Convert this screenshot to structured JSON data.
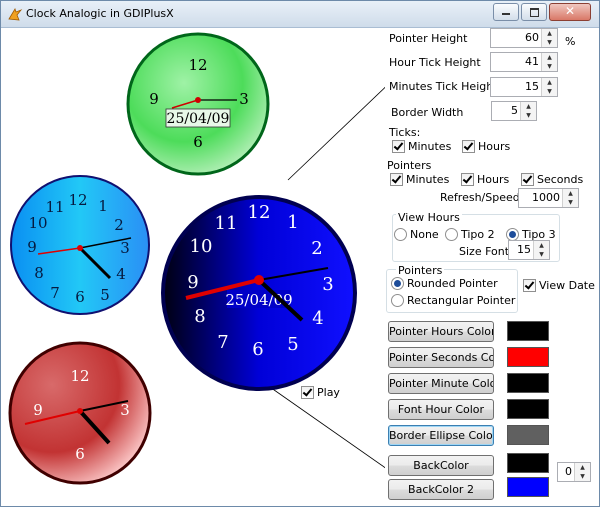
{
  "window": {
    "title": "Clock Analogic in GDIPlusX"
  },
  "clocks": {
    "green": {
      "n12": "12",
      "n3": "3",
      "n6": "6",
      "n9": "9",
      "date": "25/04/09"
    },
    "blue_small": {
      "numbers": [
        "12",
        "1",
        "2",
        "3",
        "4",
        "5",
        "6",
        "7",
        "8",
        "9",
        "10",
        "11"
      ]
    },
    "blue_big": {
      "numbers": [
        "12",
        "1",
        "2",
        "3",
        "4",
        "5",
        "6",
        "7",
        "8",
        "9",
        "10",
        "11"
      ],
      "date": "25/04/09"
    },
    "red": {
      "n12": "12",
      "n3": "3",
      "n6": "6",
      "n9": "9"
    }
  },
  "play": {
    "label": "Play",
    "checked": true
  },
  "settings": {
    "pointer_height": {
      "label": "Pointer Height",
      "value": "60",
      "unit": "%"
    },
    "hour_tick_height": {
      "label": "Hour Tick Height",
      "value": "41"
    },
    "minutes_tick_height": {
      "label": "Minutes Tick Height",
      "value": "15"
    },
    "border_width": {
      "label": "Border Width",
      "value": "5"
    },
    "ticks_label": "Ticks:",
    "ticks_minutes": "Minutes",
    "ticks_hours": "Hours",
    "pointers_label": "Pointers",
    "pointers_minutes": "Minutes",
    "pointers_hours": "Hours",
    "pointers_seconds": "Seconds",
    "refresh": {
      "label": "Refresh/Speed:",
      "value": "1000"
    },
    "view_hours": {
      "title": "View Hours",
      "none": "None",
      "tipo2": "Tipo 2",
      "tipo3": "Tipo 3",
      "selected": "Tipo 3"
    },
    "size_font": {
      "label": "Size Font",
      "value": "15"
    },
    "pointer_style": {
      "title": "Pointers",
      "rounded": "Rounded Pointer",
      "rectangular": "Rectangular Pointer",
      "selected": "Rounded Pointer"
    },
    "view_date": {
      "label": "View Date",
      "checked": true
    },
    "backcolor_index": "0"
  },
  "color_buttons": [
    {
      "label": "Pointer Hours Color",
      "color": "#000000"
    },
    {
      "label": "Pointer Seconds Col",
      "color": "#ff0000"
    },
    {
      "label": "Pointer Minute Color",
      "color": "#000000"
    },
    {
      "label": "Font Hour Color",
      "color": "#000000"
    },
    {
      "label": "Border Ellipse Color",
      "color": "#606060"
    },
    {
      "label": "BackColor",
      "color": "#000000"
    },
    {
      "label": "BackColor 2",
      "color": "#0000ff"
    }
  ]
}
